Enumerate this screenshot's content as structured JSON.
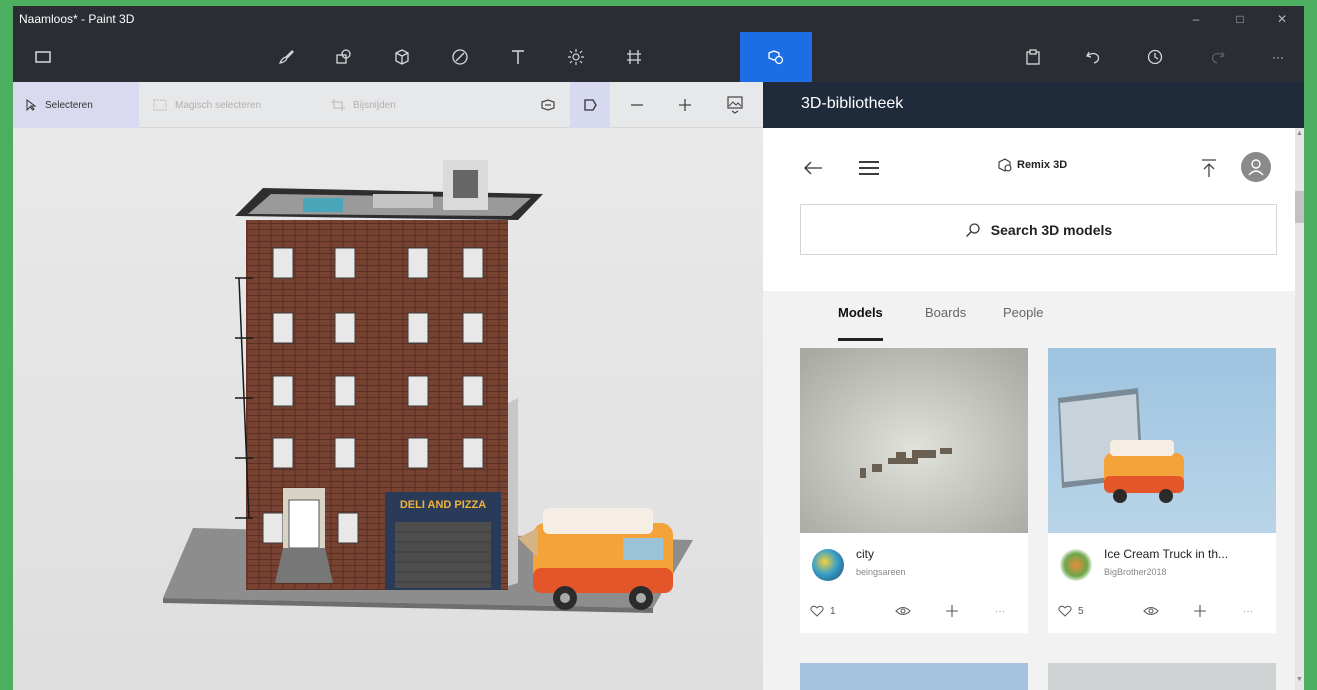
{
  "window": {
    "title": "Naamloos* - Paint 3D",
    "controls": [
      "–",
      "□",
      "✕"
    ]
  },
  "toolbar": {
    "left_icons": [
      "menu-icon"
    ],
    "tools": [
      "brushes-icon",
      "2d-shapes-icon",
      "3d-shapes-icon",
      "stickers-icon",
      "text-icon",
      "effects-icon",
      "canvas-icon",
      "3d-library-icon"
    ],
    "right_icons": [
      "paste-icon",
      "undo-icon",
      "history-icon",
      "redo-icon",
      "more-icon"
    ],
    "more_label": "···"
  },
  "subtoolbar": {
    "select_label": "Selecteren",
    "magic_select_label": "Magisch selecteren",
    "crop_label": "Bijsnijden"
  },
  "library": {
    "header_title": "3D-bibliotheek",
    "brand_label": "Remix 3D",
    "search_label": "Search 3D models",
    "tabs": [
      {
        "label": "Models",
        "active": true
      },
      {
        "label": "Boards",
        "active": false
      },
      {
        "label": "People",
        "active": false
      }
    ],
    "cards": [
      {
        "name": "city",
        "author": "beingsareen",
        "likes": "1"
      },
      {
        "name": "Ice Cream Truck in th...",
        "author": "BigBrother2018",
        "likes": "5"
      }
    ],
    "more_label": "···"
  },
  "canvas": {
    "sign_text": "DELI AND PIZZA"
  },
  "colors": {
    "accent": "#1d6ee6",
    "titlebar": "#2a2d34",
    "library_header": "#1f2a3a",
    "frame_border": "#4caf5f"
  }
}
